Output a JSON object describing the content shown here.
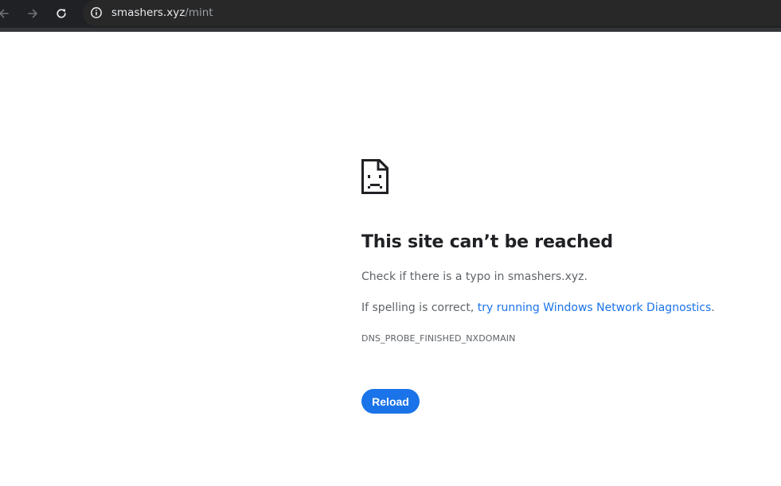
{
  "browser": {
    "address_bar": {
      "host": "smashers.xyz",
      "path": "/mint"
    },
    "icons": {
      "back": "back-arrow-icon",
      "forward": "forward-arrow-icon",
      "reload": "reload-icon",
      "site_info": "info-circle-icon"
    },
    "colors": {
      "toolbar": "#202124",
      "omnibox": "#282828",
      "url_host": "#e8eaed",
      "url_path": "#9aa0a6"
    }
  },
  "error_page": {
    "icon": "sad-page-icon",
    "title": "This site can’t be reached",
    "line1": "Check if there is a typo in smashers.xyz.",
    "line2_prefix": "If spelling is correct, ",
    "line2_link": "try running Windows Network Diagnostics",
    "line2_suffix": ".",
    "error_code": "DNS_PROBE_FINISHED_NXDOMAIN",
    "reload_label": "Reload",
    "colors": {
      "title": "#202124",
      "body_text": "#5f6368",
      "link": "#1a73e8",
      "button": "#1a73e8"
    }
  }
}
